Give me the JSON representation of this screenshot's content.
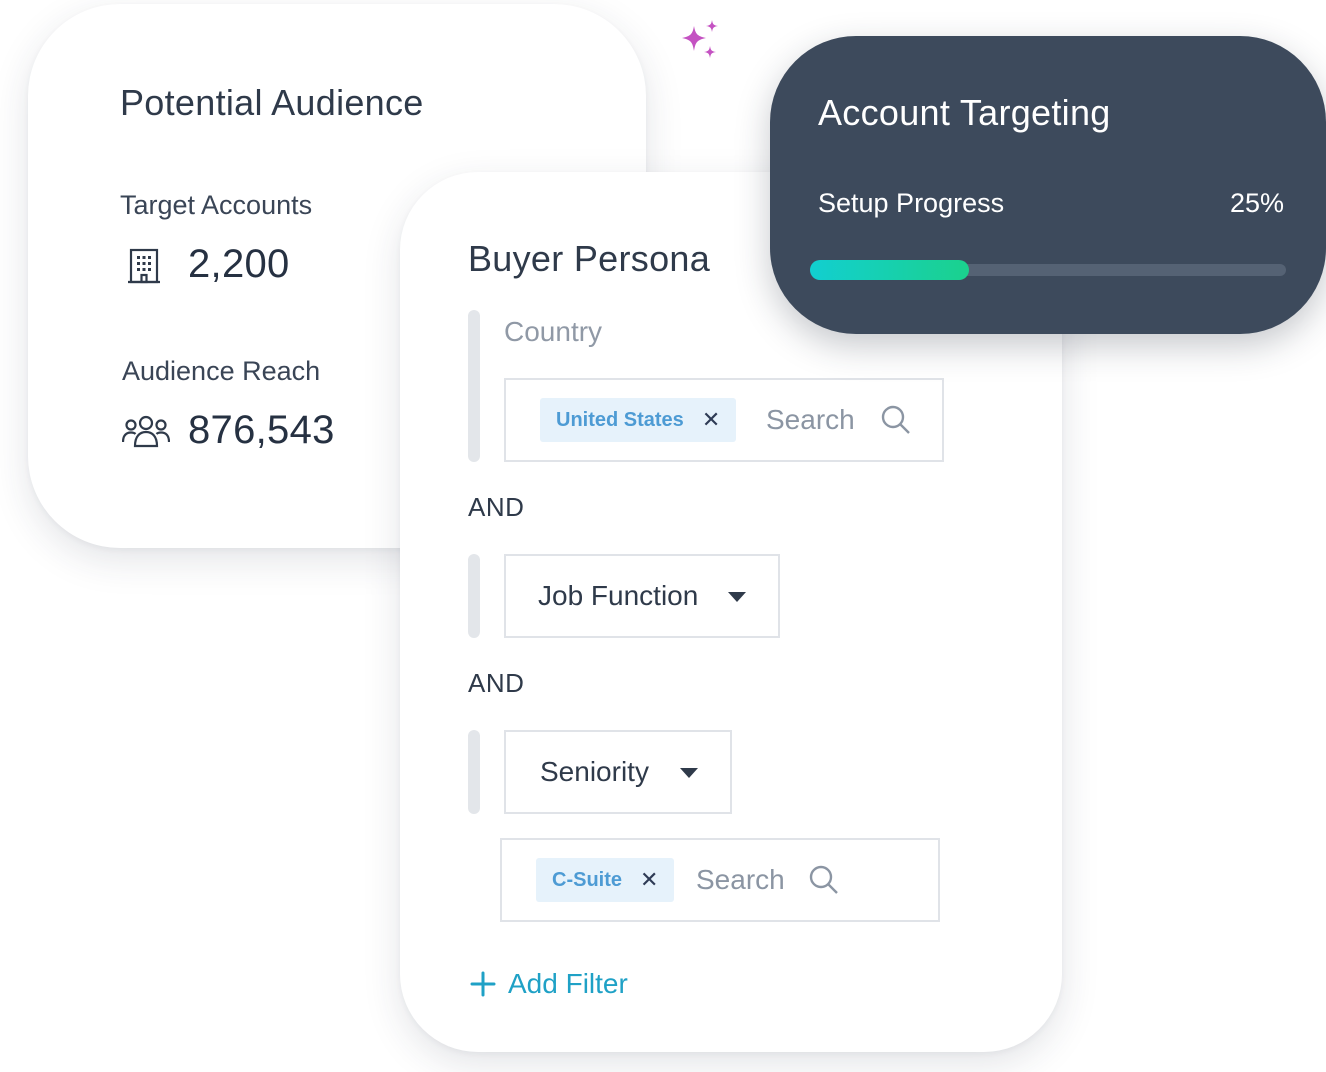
{
  "audience": {
    "title": "Potential Audience",
    "target_accounts_label": "Target Accounts",
    "target_accounts_value": "2,200",
    "audience_reach_label": "Audience Reach",
    "audience_reach_value": "876,543"
  },
  "persona": {
    "title": "Buyer Persona",
    "country_label": "Country",
    "country_chip": "United States",
    "search_placeholder": "Search",
    "and_label": "AND",
    "job_function_label": "Job Function",
    "seniority_label": "Seniority",
    "seniority_chip": "C-Suite",
    "add_filter_label": "Add Filter"
  },
  "targeting": {
    "title": "Account Targeting",
    "progress_label": "Setup Progress",
    "progress_text": "25%",
    "progress_fraction": 0.25
  },
  "colors": {
    "dark_card": "#3d4a5c",
    "progress_start": "#12cfd0",
    "progress_end": "#1bd18d",
    "accent_link": "#1fa1c6",
    "chip_bg": "#e6f2fb",
    "chip_text": "#4d9bd4",
    "sparkle": "#c452c2"
  },
  "icons": {
    "accounts": "building-icon",
    "reach": "users-group-icon",
    "search": "search-icon",
    "remove": "close-icon",
    "dropdown": "caret-down-icon",
    "add": "plus-icon",
    "decoration": "sparkle-icon"
  }
}
